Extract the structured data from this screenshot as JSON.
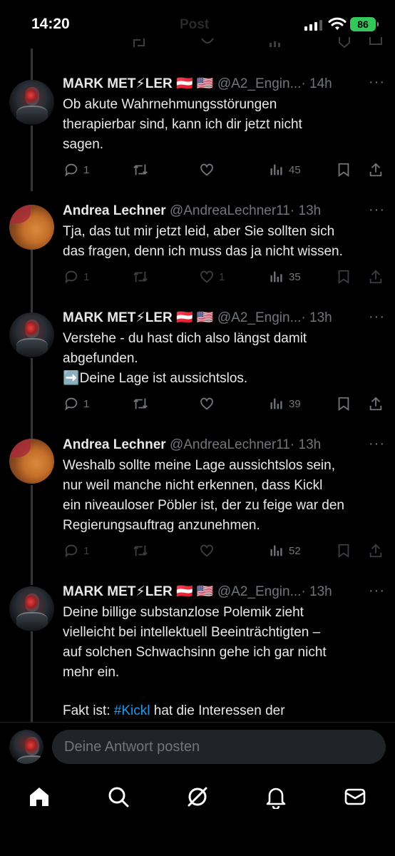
{
  "status_bar": {
    "time": "14:20",
    "faded_title": "Post",
    "battery": "86"
  },
  "tweets": [
    {
      "author": "MARK MET⚡LER 🇦🇹 🇺🇸",
      "handle": "@A2_Engin...",
      "time": "· 14h",
      "text": "Ob akute Wahrnehmungsstörungen\ntherapierbar sind, kann ich dir jetzt nicht\nsagen.",
      "replies": "1",
      "reposts": "",
      "likes": "",
      "views": "45"
    },
    {
      "author": "Andrea Lechner",
      "handle": "@AndreaLechner11",
      "time": "· 13h",
      "text": "Tja, das tut mir jetzt leid, aber Sie sollten sich\ndas fragen, denn ich muss das ja nicht wissen.",
      "replies": "1",
      "reposts": "",
      "likes": "1",
      "views": "35"
    },
    {
      "author": "MARK MET⚡LER 🇦🇹 🇺🇸",
      "handle": "@A2_Engin...",
      "time": "· 13h",
      "text": "Verstehe - du hast dich also längst damit\nabgefunden.\n➡️Deine Lage ist aussichtslos.",
      "replies": "1",
      "reposts": "",
      "likes": "",
      "views": "39"
    },
    {
      "author": "Andrea Lechner",
      "handle": "@AndreaLechner11",
      "time": "· 13h",
      "text": "Weshalb sollte meine Lage aussichtslos sein,\nnur weil manche nicht erkennen, dass Kickl\nein niveauloser Pöbler ist, der zu feige war den\nRegierungsauftrag anzunehmen.",
      "replies": "1",
      "reposts": "",
      "likes": "",
      "views": "52"
    },
    {
      "author": "MARK MET⚡LER 🇦🇹 🇺🇸",
      "handle": "@A2_Engin...",
      "time": "· 13h",
      "text": "Deine billige substanzlose Polemik zieht\nvielleicht bei intellektuell Beeinträchtigten –\nauf solchen Schwachsinn gehe ich gar nicht\nmehr ein.",
      "text2_prefix": "Fakt ist: ",
      "text2_hashtag": "#Kickl",
      "text2_suffix": " hat die Interessen der"
    }
  ],
  "reply_bar": {
    "placeholder": "Deine Antwort posten"
  },
  "nav": [
    "home-icon",
    "search-icon",
    "grok-icon",
    "notifications-icon",
    "messages-icon"
  ],
  "colors": {
    "background": "#000000",
    "text": "#e7e9ea",
    "muted": "#71767b",
    "link": "#1d9bf0",
    "battery": "#34c759"
  }
}
